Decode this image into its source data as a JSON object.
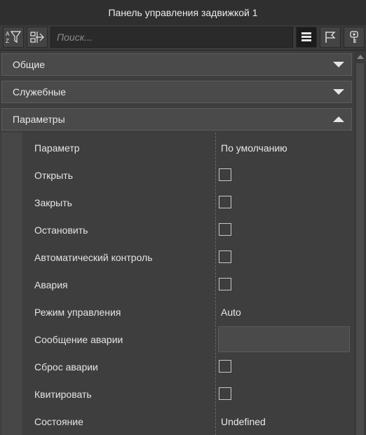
{
  "window": {
    "title": "Панель управления задвижкой 1"
  },
  "toolbar": {
    "sort_icon": "sort-az-icon",
    "filter_icon": "filter-icon",
    "collapse_icon": "collapse-tree-icon",
    "search": {
      "placeholder": "Поиск...",
      "value": ""
    },
    "list_icon": "list-view-icon",
    "flag_icon": "flag-icon",
    "key_icon": "key-icon"
  },
  "sections": [
    {
      "label": "Общие",
      "expanded": false
    },
    {
      "label": "Служебные",
      "expanded": false
    },
    {
      "label": "Параметры",
      "expanded": true
    }
  ],
  "params": {
    "header": {
      "name": "Параметр",
      "value": "По умолчанию"
    },
    "rows": [
      {
        "name": "Открыть",
        "type": "checkbox",
        "checked": false
      },
      {
        "name": "Закрыть",
        "type": "checkbox",
        "checked": false
      },
      {
        "name": "Остановить",
        "type": "checkbox",
        "checked": false
      },
      {
        "name": "Автоматический контроль",
        "type": "checkbox",
        "checked": false
      },
      {
        "name": "Авария",
        "type": "checkbox",
        "checked": false
      },
      {
        "name": "Режим управления",
        "type": "text",
        "value": "Auto"
      },
      {
        "name": "Сообщение аварии",
        "type": "textbox",
        "value": ""
      },
      {
        "name": "Сброс аварии",
        "type": "checkbox",
        "checked": false
      },
      {
        "name": "Квитировать",
        "type": "checkbox",
        "checked": false
      },
      {
        "name": "Состояние",
        "type": "text",
        "value": "Undefined"
      }
    ]
  },
  "colors": {
    "background": "#3e3e3e",
    "titlebar": "#2f2f2f",
    "section_header": "#4a4a4a",
    "text": "#e6e6e6"
  }
}
